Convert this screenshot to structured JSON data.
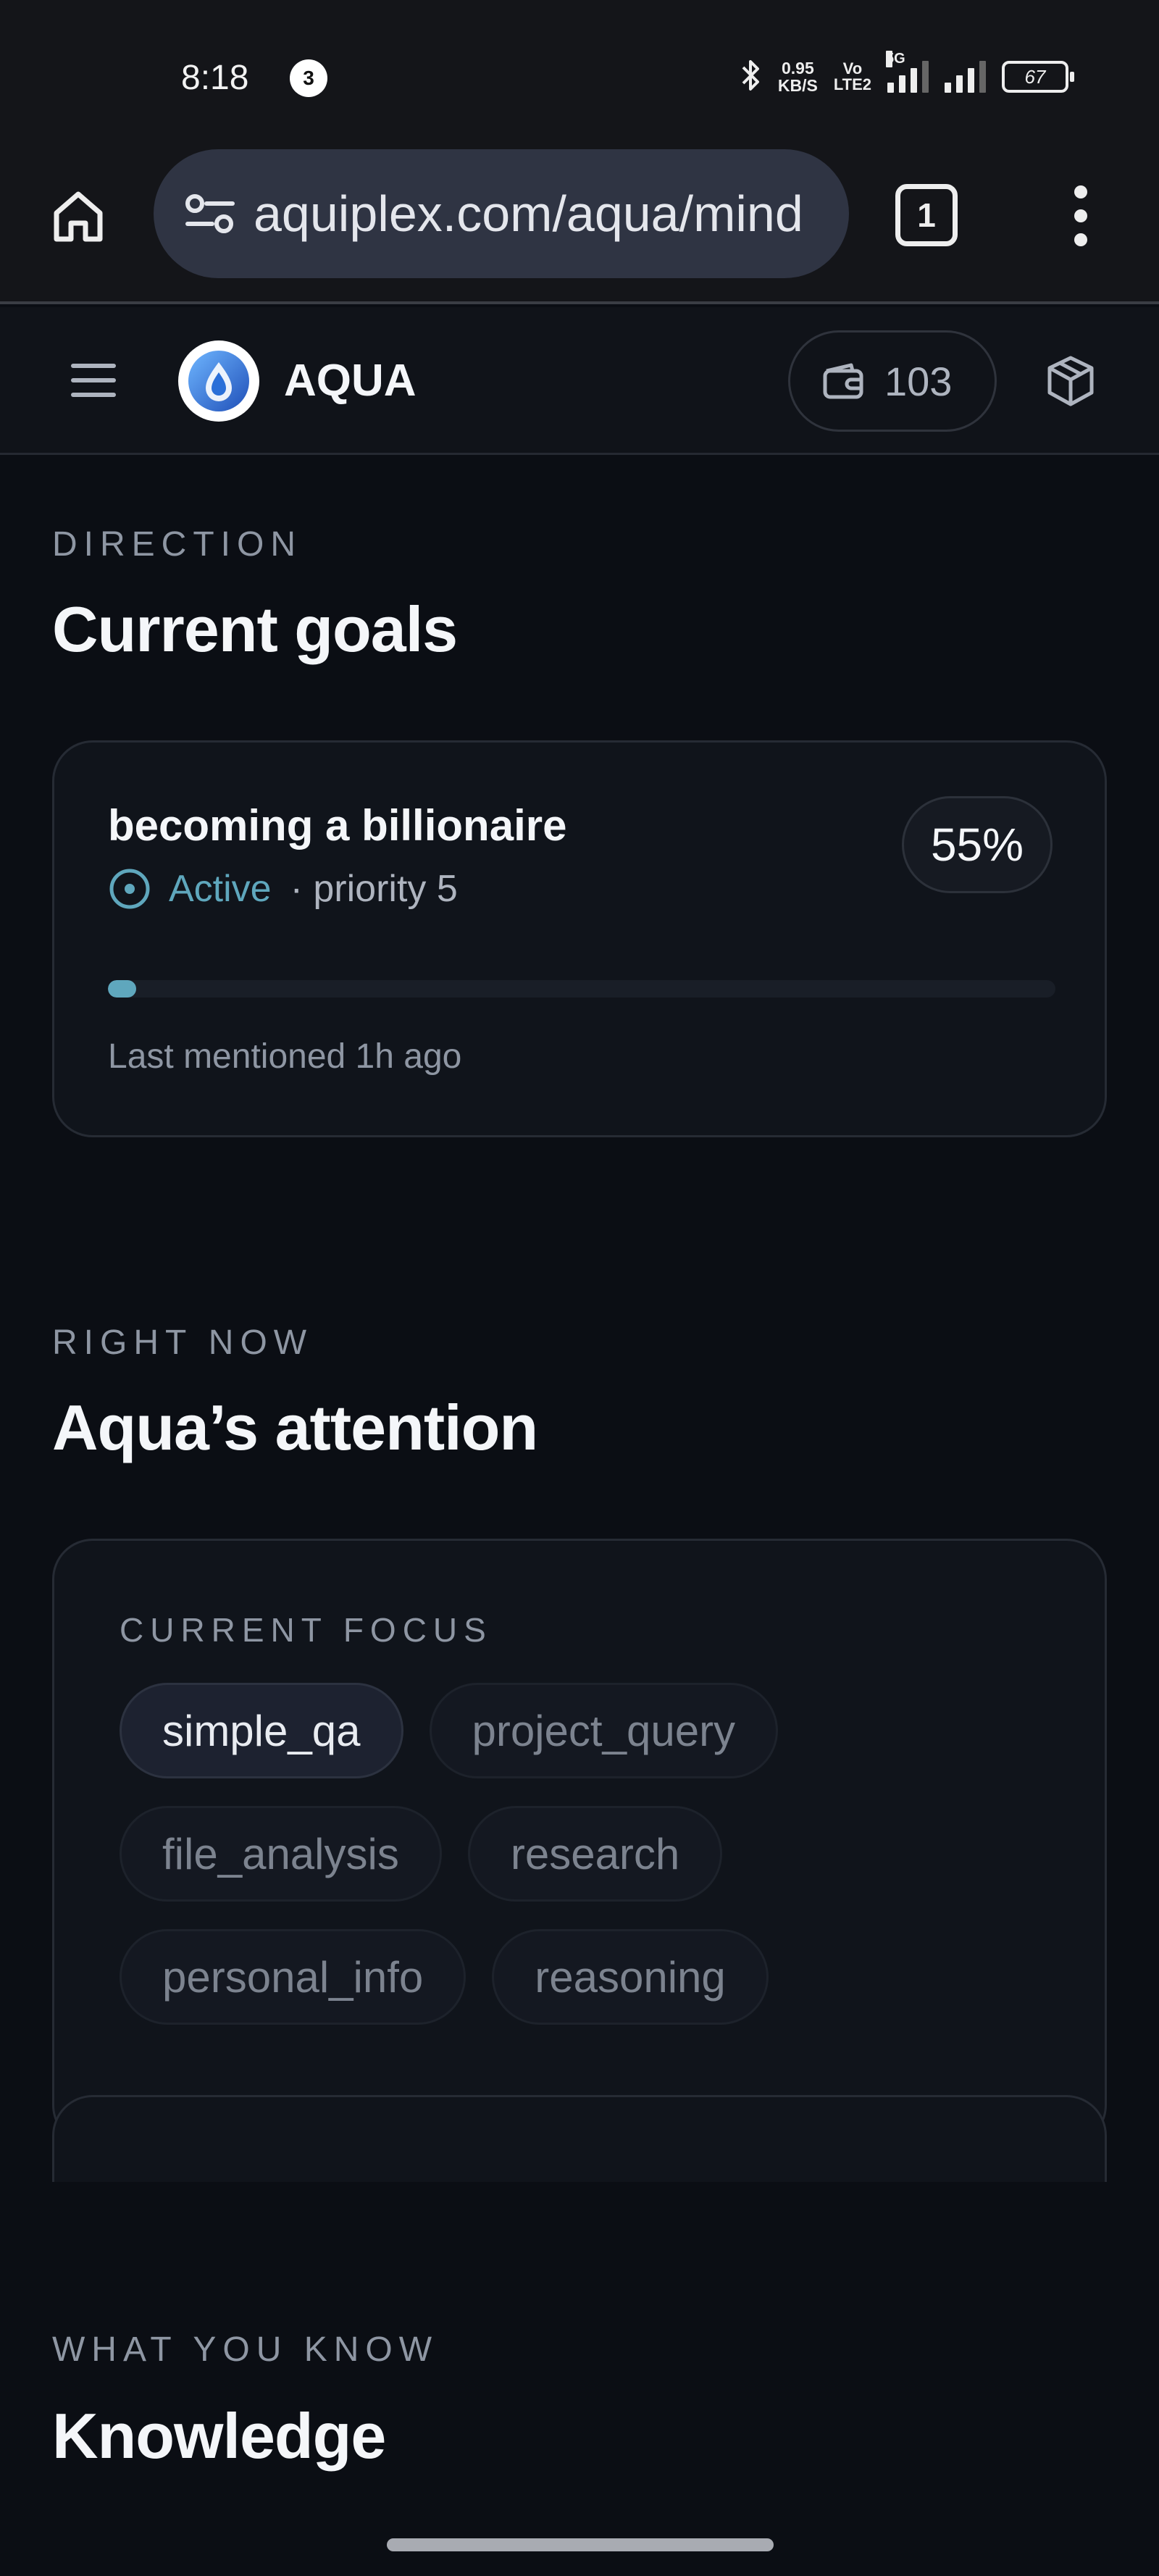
{
  "status_bar": {
    "time": "8:18",
    "notification_count": "3",
    "speed_value": "0.95",
    "speed_unit": "KB/S",
    "volte_top": "Vo",
    "volte_bottom": "LTE2",
    "network": "5G",
    "battery": "67"
  },
  "browser": {
    "url": "aquiplex.com/aqua/mind",
    "tab_count": "1"
  },
  "app_header": {
    "brand": "AQUA",
    "credits": "103"
  },
  "goals": {
    "eyebrow": "DIRECTION",
    "title": "Current goals",
    "items": [
      {
        "title": "becoming a billionaire",
        "status": "Active",
        "priority": "· priority 5",
        "percent": "55%",
        "progress_fill": 0.03,
        "last_mentioned": "Last mentioned 1h ago"
      }
    ]
  },
  "attention": {
    "eyebrow": "RIGHT NOW",
    "title": "Aqua’s attention",
    "focus_label": "CURRENT FOCUS",
    "chips": [
      "simple_qa",
      "project_query",
      "file_analysis",
      "research",
      "personal_info",
      "reasoning"
    ],
    "active_chip": "simple_qa"
  },
  "knowledge": {
    "eyebrow": "WHAT YOU KNOW",
    "title": "Knowledge"
  },
  "colors": {
    "background": "#0b0e14",
    "accent": "#5fa7bd",
    "card": "#10141b"
  },
  "icons": {
    "home": "home-icon",
    "site_settings": "tune-icon",
    "menu": "hamburger-menu-icon",
    "wallet": "wallet-icon",
    "cube": "cube-icon",
    "status": "target-icon"
  }
}
